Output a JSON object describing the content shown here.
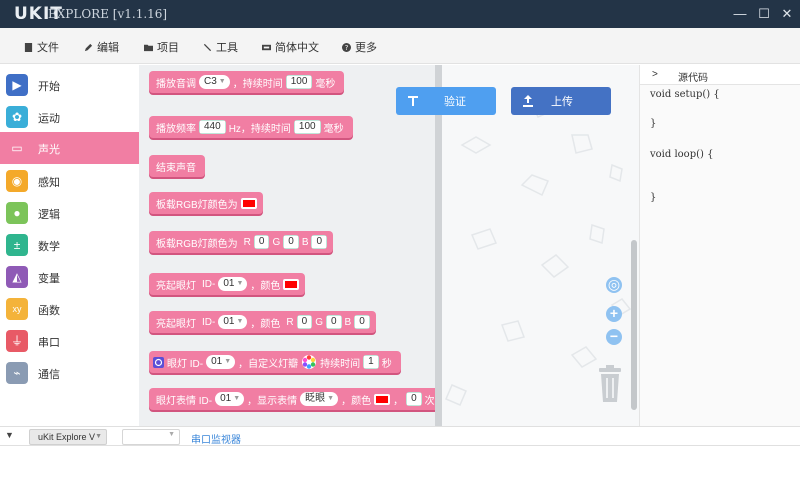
{
  "app": {
    "logo": "UKIT",
    "title": "EXPLORE [v1.1.16]"
  },
  "window_controls": {
    "minimize": "—",
    "maximize": "☐",
    "close": "✕"
  },
  "menu": [
    {
      "label": "文件",
      "icon": "file-icon"
    },
    {
      "label": "编辑",
      "icon": "edit-icon"
    },
    {
      "label": "项目",
      "icon": "folder-icon"
    },
    {
      "label": "工具",
      "icon": "wrench-icon"
    },
    {
      "label": "简体中文",
      "icon": "language-icon"
    },
    {
      "label": "更多",
      "icon": "help-icon"
    }
  ],
  "categories": [
    {
      "label": "开始",
      "color": "#3f6fc6",
      "icon": "play-icon",
      "glyph": "▶"
    },
    {
      "label": "运动",
      "color": "#3aaed8",
      "icon": "motion-icon",
      "glyph": "✿"
    },
    {
      "label": "声光",
      "color": "#f17ea3",
      "icon": "monitor-icon",
      "glyph": "▭",
      "active": true
    },
    {
      "label": "感知",
      "color": "#f4a92a",
      "icon": "sensor-icon",
      "glyph": "◉"
    },
    {
      "label": "逻辑",
      "color": "#7cc45a",
      "icon": "bulb-icon",
      "glyph": "●"
    },
    {
      "label": "数学",
      "color": "#2fb58e",
      "icon": "math-icon",
      "glyph": "±"
    },
    {
      "label": "变量",
      "color": "#8f5ab6",
      "icon": "variable-icon",
      "glyph": "◭"
    },
    {
      "label": "函数",
      "color": "#f4b33a",
      "icon": "function-icon",
      "glyph": "xy"
    },
    {
      "label": "串口",
      "color": "#e85a66",
      "icon": "usb-icon",
      "glyph": "⏚"
    },
    {
      "label": "通信",
      "color": "#8a9bb3",
      "icon": "satellite-icon",
      "glyph": "⌁"
    }
  ],
  "blocks": {
    "b1": {
      "t1": "播放音调",
      "note": "C3",
      "t2": "，持续时间",
      "v": "100",
      "t3": "毫秒"
    },
    "b2": {
      "t1": "播放频率",
      "f": "440",
      "t2": "Hz，持续时间",
      "v": "100",
      "t3": "毫秒"
    },
    "b3": {
      "t1": "结束声音"
    },
    "b4": {
      "t1": "板载RGB灯颜色为",
      "color": "#ff0000"
    },
    "b5": {
      "t1": "板载RGB灯颜色为",
      "r": "R",
      "rv": "0",
      "g": "G",
      "gv": "0",
      "b": "B",
      "bv": "0"
    },
    "b6": {
      "t1": "亮起眼灯",
      "id": "ID-",
      "idv": "01",
      "t2": "，颜色",
      "color": "#ff0000"
    },
    "b7": {
      "t1": "亮起眼灯",
      "id": "ID-",
      "idv": "01",
      "t2": "，颜色",
      "r": "R",
      "rv": "0",
      "g": "G",
      "gv": "0",
      "b": "B",
      "bv": "0"
    },
    "b8": {
      "t1": "眼灯 ID-",
      "idv": "01",
      "t2": "，自定义灯瓣",
      "t3": "持续时间",
      "v": "1",
      "t4": "秒"
    },
    "b9": {
      "t1": "眼灯表情 ID-",
      "idv": "01",
      "t2": "，显示表情",
      "expr": "眨眼",
      "t3": "，颜色",
      "color": "#ff0000",
      "t4": "，",
      "v": "0",
      "t5": "次"
    }
  },
  "workspace": {
    "verify_label": "验证",
    "upload_label": "上传"
  },
  "code": {
    "title": "源代码",
    "toggle": ">",
    "lines": [
      "void setup() {",
      "",
      "}",
      "",
      "void loop() {",
      "",
      "",
      "",
      "}"
    ]
  },
  "bottom": {
    "device": "uKit Explore V",
    "serial_monitor": "串口监视器"
  }
}
